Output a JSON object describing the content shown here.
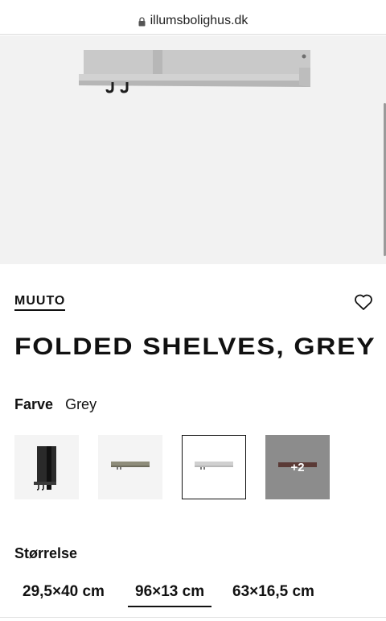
{
  "browser": {
    "url": "illumsbolighus.dk"
  },
  "product": {
    "brand": "MUUTO",
    "title": "FOLDED SHELVES, GREY",
    "color_label": "Farve",
    "color_value": "Grey",
    "swatches": [
      {
        "name": "Black"
      },
      {
        "name": "Green"
      },
      {
        "name": "Grey",
        "selected": true
      },
      {
        "name": "more",
        "label": "+2"
      }
    ],
    "size_label": "Størrelse",
    "sizes": [
      {
        "label": "29,5×40 cm"
      },
      {
        "label": "96×13 cm",
        "active": true
      },
      {
        "label": "63×16,5 cm"
      }
    ]
  },
  "colors": {
    "hero_bg": "#f2f2f2",
    "shelf_grey": "#c4c4c4",
    "more_swatch": "#8c8c8c"
  }
}
